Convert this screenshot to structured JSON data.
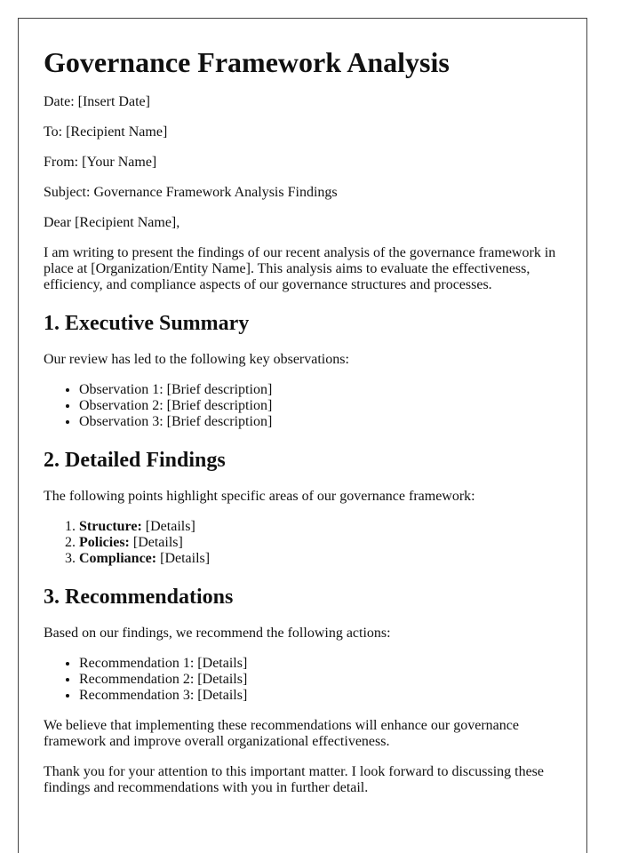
{
  "document": {
    "title": "Governance Framework Analysis",
    "header_fields": [
      "Date: [Insert Date]",
      "To: [Recipient Name]",
      "From: [Your Name]",
      "Subject: Governance Framework Analysis Findings"
    ],
    "salutation": "Dear [Recipient Name],",
    "intro": "I am writing to present the findings of our recent analysis of the governance framework in place at [Organization/Entity Name]. This analysis aims to evaluate the effectiveness, efficiency, and compliance aspects of our governance structures and processes.",
    "sections": {
      "summary": {
        "heading": "1. Executive Summary",
        "lead": "Our review has led to the following key observations:",
        "items": [
          "Observation 1: [Brief description]",
          "Observation 2: [Brief description]",
          "Observation 3: [Brief description]"
        ]
      },
      "findings": {
        "heading": "2. Detailed Findings",
        "lead": "The following points highlight specific areas of our governance framework:",
        "items": [
          {
            "label": "Structure:",
            "text": " [Details]"
          },
          {
            "label": "Policies:",
            "text": " [Details]"
          },
          {
            "label": "Compliance:",
            "text": " [Details]"
          }
        ]
      },
      "recommendations": {
        "heading": "3. Recommendations",
        "lead": "Based on our findings, we recommend the following actions:",
        "items": [
          "Recommendation 1: [Details]",
          "Recommendation 2: [Details]",
          "Recommendation 3: [Details]"
        ]
      }
    },
    "closing_1": "We believe that implementing these recommendations will enhance our governance framework and improve overall organizational effectiveness.",
    "closing_2": "Thank you for your attention to this important matter. I look forward to discussing these findings and recommendations with you in further detail."
  }
}
